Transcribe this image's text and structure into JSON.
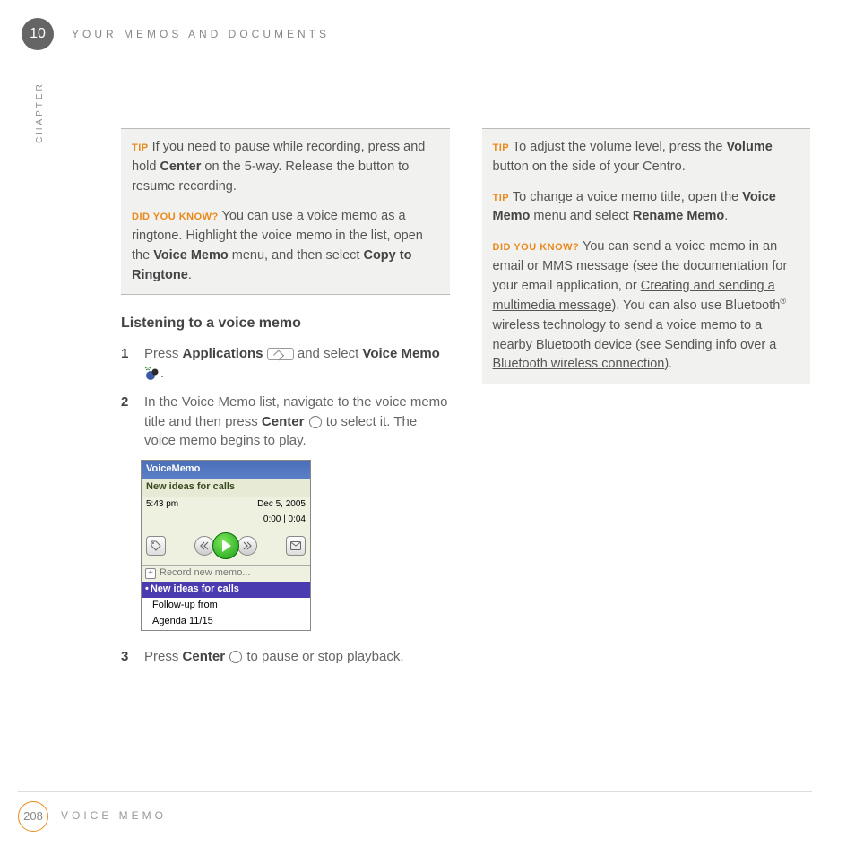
{
  "header": {
    "chapter_number": "10",
    "chapter_title": "YOUR MEMOS AND DOCUMENTS",
    "chapter_label": "CHAPTER"
  },
  "left": {
    "box": {
      "tip_label": "TIP",
      "tip_text_a": "If you need to pause while recording, press and hold ",
      "tip_bold": "Center",
      "tip_text_b": " on the 5-way. Release the button to resume recording.",
      "dyk_label": "DID YOU KNOW?",
      "dyk_text_a": "You can use a voice memo as a ringtone. Highlight the voice memo in the list, open the ",
      "dyk_bold_a": "Voice Memo",
      "dyk_text_b": " menu, and then select ",
      "dyk_bold_b": "Copy to Ringtone",
      "dyk_text_c": "."
    },
    "heading": "Listening to a voice memo",
    "steps": {
      "s1_a": "Press ",
      "s1_apps": "Applications",
      "s1_b": " and select ",
      "s1_vm": "Voice Memo",
      "s1_c": ".",
      "s2_a": "In the Voice Memo list, navigate to the voice memo title and then press ",
      "s2_center": "Center",
      "s2_b": " to select it. The voice memo begins to play.",
      "s3_a": "Press ",
      "s3_center": "Center",
      "s3_b": " to pause or stop playback."
    },
    "app": {
      "title": "VoiceMemo",
      "subtitle": "New ideas for calls",
      "time": "5:43 pm",
      "date": "Dec 5, 2005",
      "elapsed": "0:00",
      "total": "0:04",
      "record_label": "Record new memo...",
      "list": {
        "selected": "New ideas for calls",
        "item2": "Follow-up from",
        "item3": "Agenda 11/15"
      }
    }
  },
  "right": {
    "box": {
      "tip1_label": "TIP",
      "tip1_a": "To adjust the volume level, press the ",
      "tip1_bold": "Volume",
      "tip1_b": " button on the side of your Centro.",
      "tip2_label": "TIP",
      "tip2_a": "To change a voice memo title, open the ",
      "tip2_bold_a": "Voice Memo",
      "tip2_b": " menu and select ",
      "tip2_bold_b": "Rename Memo",
      "tip2_c": ".",
      "dyk_label": "DID YOU KNOW?",
      "dyk_a": "You can send a voice memo in an email or MMS message (see the documentation for your email application, or ",
      "dyk_link1": "Creating and sending a multimedia message",
      "dyk_b": "). You can also use Bluetooth",
      "dyk_reg": "®",
      "dyk_c": " wireless technology to send a voice memo to a nearby Bluetooth device (see ",
      "dyk_link2": "Sending info over a Bluetooth wireless connection",
      "dyk_d": ")."
    }
  },
  "footer": {
    "page": "208",
    "label": "VOICE MEMO"
  }
}
